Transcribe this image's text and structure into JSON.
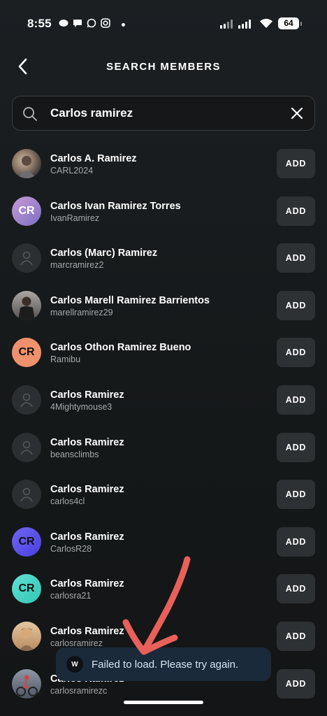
{
  "status_bar": {
    "time": "8:55",
    "notification_icons": [
      "message-bubble-icon",
      "chat-icon",
      "whatsapp-icon",
      "instagram-icon"
    ],
    "battery": "64"
  },
  "header": {
    "title": "SEARCH MEMBERS",
    "back_icon": "chevron-left-icon"
  },
  "search": {
    "value": "Carlos ramirez",
    "search_icon": "search-icon",
    "clear_icon": "close-icon"
  },
  "members": [
    {
      "name": "Carlos A. Ramirez",
      "username": "CARL2024",
      "avatar": "photo",
      "button": "ADD"
    },
    {
      "name": "Carlos Ivan Ramirez Torres",
      "username": "IvanRamirez",
      "avatar": "CR",
      "avatar_color": "#9b7bc7",
      "button": "ADD"
    },
    {
      "name": "Carlos (Marc) Ramirez",
      "username": "marcramirez2",
      "avatar": "placeholder",
      "button": "ADD"
    },
    {
      "name": "Carlos Marell Ramirez Barrientos",
      "username": "marellramirez29",
      "avatar": "photo",
      "button": "ADD"
    },
    {
      "name": "Carlos Othon Ramirez Bueno",
      "username": "Ramibu",
      "avatar": "CR",
      "avatar_color": "#f08c6e",
      "button": "ADD"
    },
    {
      "name": "Carlos Ramirez",
      "username": "4Mightymouse3",
      "avatar": "placeholder",
      "button": "ADD"
    },
    {
      "name": "Carlos Ramirez",
      "username": "beansclimbs",
      "avatar": "placeholder",
      "button": "ADD"
    },
    {
      "name": "Carlos Ramirez",
      "username": "carlos4cl",
      "avatar": "placeholder",
      "button": "ADD"
    },
    {
      "name": "Carlos Ramirez",
      "username": "CarlosR28",
      "avatar": "CR",
      "avatar_color": "#5b55e6",
      "button": "ADD"
    },
    {
      "name": "Carlos Ramirez",
      "username": "carlosra21",
      "avatar": "CR",
      "avatar_color": "#4fd6c6",
      "button": "ADD"
    },
    {
      "name": "Carlos Ramirez",
      "username": "carlosramirez",
      "avatar": "photo",
      "button": "ADD"
    },
    {
      "name": "Carlos Ramirez",
      "username": "carlosramirezc",
      "avatar": "photo",
      "button": "ADD"
    }
  ],
  "toast": {
    "icon": "W",
    "message": "Failed to load. Please try again."
  },
  "colors": {
    "background": "#171a1c",
    "button_bg": "#2e3134",
    "toast_bg": "#1b2a3a",
    "annotation_arrow": "#e8605a"
  }
}
